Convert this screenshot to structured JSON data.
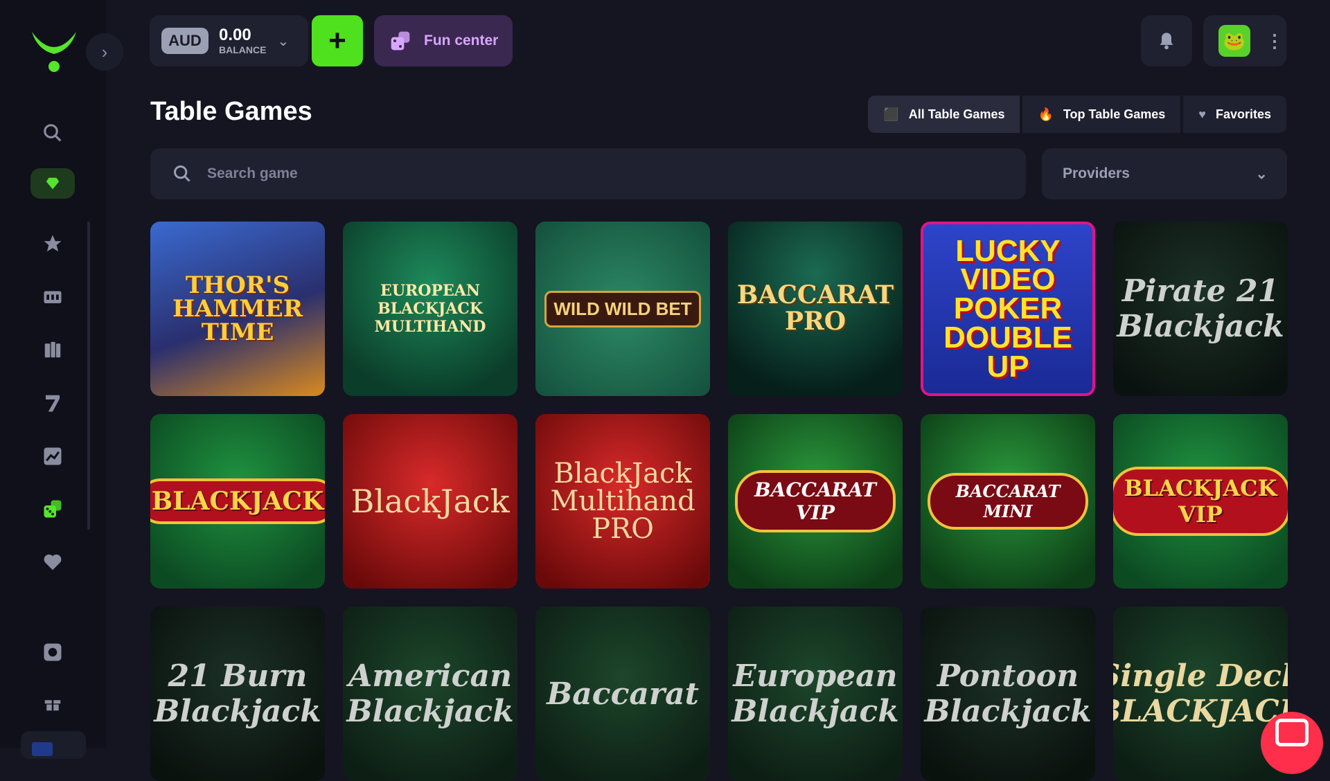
{
  "colors": {
    "accent_green": "#55e52a",
    "background": "#141521",
    "sidebar": "#0f1019",
    "panel": "#1f2030",
    "fun_center": "#d9a6ff",
    "chat": "#ff2e4a"
  },
  "sidebar": {
    "logo_icon": "logo-icon",
    "items": [
      {
        "name": "search",
        "icon": "search-icon"
      },
      {
        "name": "vip",
        "icon": "gem-icon"
      },
      {
        "name": "favorites",
        "icon": "star-icon"
      },
      {
        "name": "slots",
        "icon": "slot-machine-icon"
      },
      {
        "name": "live-casino",
        "icon": "dealer-icon"
      },
      {
        "name": "lucky-seven",
        "icon": "seven-icon"
      },
      {
        "name": "crash",
        "icon": "chart-icon"
      },
      {
        "name": "table-games",
        "icon": "dice-icon"
      },
      {
        "name": "liked",
        "icon": "heart-icon"
      },
      {
        "name": "sports",
        "icon": "ball-icon"
      },
      {
        "name": "promotions",
        "icon": "gift-icon"
      }
    ]
  },
  "header": {
    "currency": "AUD",
    "balance_amount": "0.00",
    "balance_label": "BALANCE",
    "deposit_label": "+",
    "fun_center_label": "Fun center"
  },
  "page": {
    "title": "Table Games",
    "tabs": [
      {
        "label": "All Table Games",
        "icon": "dice-icon"
      },
      {
        "label": "Top Table Games",
        "icon": "flame-icon"
      },
      {
        "label": "Favorites",
        "icon": "heart-icon"
      }
    ],
    "search_placeholder": "Search game",
    "providers_label": "Providers"
  },
  "games": [
    {
      "title": "THOR'S HAMMER TIME"
    },
    {
      "title": "EUROPEAN BLACKJACK MULTIHAND"
    },
    {
      "title": "WILD WILD BET"
    },
    {
      "title": "BACCARAT PRO"
    },
    {
      "title": "LUCKY VIDEO POKER DOUBLE UP"
    },
    {
      "title": "Pirate 21 Blackjack"
    },
    {
      "title": "BLACKJACK"
    },
    {
      "title": "BlackJack"
    },
    {
      "title": "BlackJack Multihand PRO"
    },
    {
      "title": "BACCARAT VIP"
    },
    {
      "title": "BACCARAT MINI"
    },
    {
      "title": "BLACKJACK VIP"
    },
    {
      "title": "21 Burn Blackjack"
    },
    {
      "title": "American Blackjack"
    },
    {
      "title": "Baccarat"
    },
    {
      "title": "European Blackjack"
    },
    {
      "title": "Pontoon Blackjack"
    },
    {
      "title": "Single Deck BLACKJACK"
    }
  ]
}
